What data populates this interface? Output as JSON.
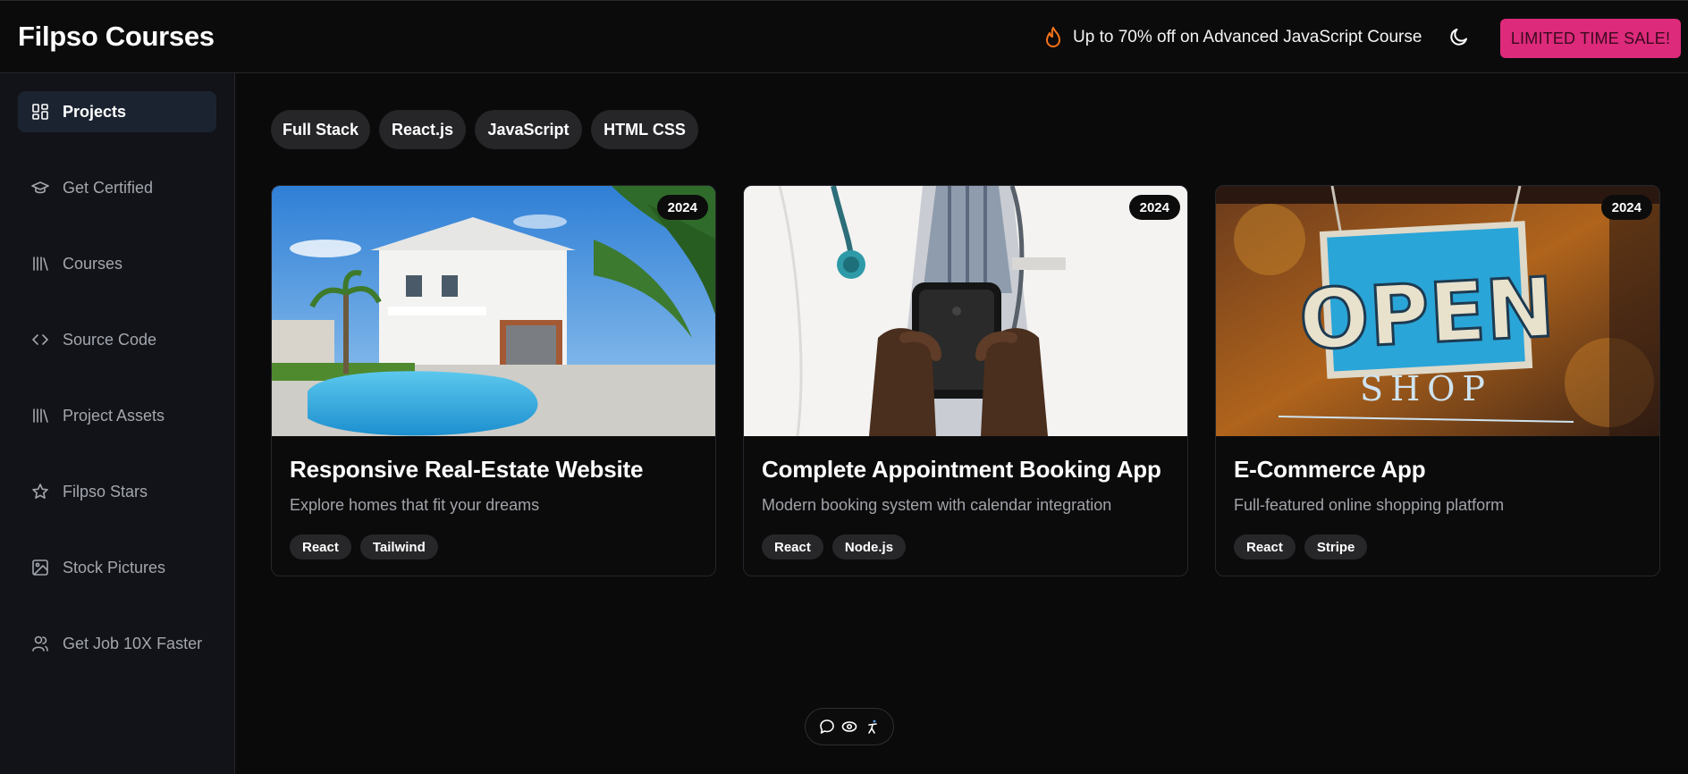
{
  "header": {
    "brand": "Filpso Courses",
    "promo_text": "Up to 70% off on Advanced JavaScript Course",
    "promo_icon": "flame-icon",
    "theme_icon": "moon-icon",
    "sale_button": "LIMITED TIME SALE!"
  },
  "colors": {
    "accent": "#dd2a7b",
    "background": "#0a0a0b",
    "sidebar": "#111318",
    "active_nav": "#1c2330",
    "flame": "#f97316"
  },
  "sidebar": {
    "items": [
      {
        "label": "Projects",
        "icon": "layout-dashboard-icon",
        "active": true
      },
      {
        "label": "Get Certified",
        "icon": "graduation-cap-icon",
        "active": false
      },
      {
        "label": "Courses",
        "icon": "library-icon",
        "active": false
      },
      {
        "label": "Source Code",
        "icon": "code-icon",
        "active": false
      },
      {
        "label": "Project Assets",
        "icon": "library-icon",
        "active": false
      },
      {
        "label": "Filpso Stars",
        "icon": "star-icon",
        "active": false
      },
      {
        "label": "Stock Pictures",
        "icon": "image-icon",
        "active": false
      },
      {
        "label": "Get Job 10X Faster",
        "icon": "users-icon",
        "active": false
      }
    ]
  },
  "filters": [
    "Full Stack",
    "React.js",
    "JavaScript",
    "HTML CSS"
  ],
  "cards": [
    {
      "year": "2024",
      "title": "Responsive Real-Estate Website",
      "description": "Explore homes that fit your dreams",
      "tags": [
        "React",
        "Tailwind"
      ],
      "image": "house-with-pool-photo"
    },
    {
      "year": "2024",
      "title": "Complete Appointment Booking App",
      "description": "Modern booking system with calendar integration",
      "tags": [
        "React",
        "Node.js"
      ],
      "image": "doctor-holding-phone-photo"
    },
    {
      "year": "2024",
      "title": "E-Commerce App",
      "description": "Full-featured online shopping platform",
      "tags": [
        "React",
        "Stripe"
      ],
      "image": "open-shop-sign-photo",
      "sign_word": "OPEN",
      "sign_sub": "SHOP"
    }
  ],
  "toolbar": {
    "icons": [
      "chat-icon",
      "eye-icon",
      "accessibility-icon"
    ]
  }
}
